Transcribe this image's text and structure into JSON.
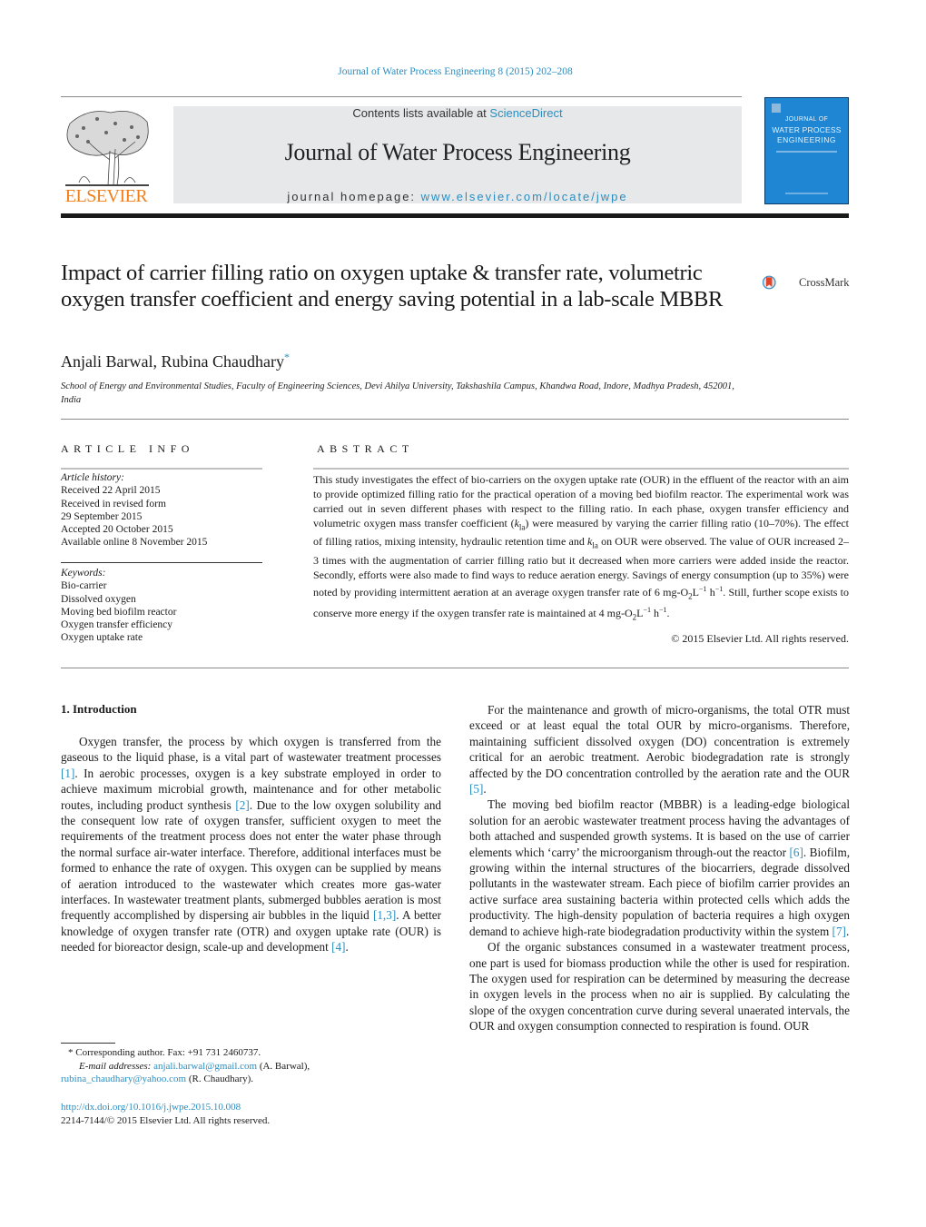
{
  "running_head": "Journal of Water Process Engineering 8 (2015) 202–208",
  "masthead": {
    "publisher": "ELSEVIER",
    "contents_prefix": "Contents lists available at ",
    "contents_link": "ScienceDirect",
    "journal_title": "Journal of Water Process Engineering",
    "homepage_prefix": "journal homepage: ",
    "homepage_link": "www.elsevier.com/locate/jwpe",
    "cover": {
      "line1": "JOURNAL OF",
      "line2": "WATER PROCESS",
      "line3": "ENGINEERING"
    }
  },
  "article": {
    "title": "Impact of carrier filling ratio on oxygen uptake & transfer rate, volumetric oxygen transfer coefficient and energy saving potential in a lab-scale MBBR",
    "crossmark_label": "CrossMark",
    "authors": "Anjali Barwal, Rubina Chaudhary",
    "corresponding_marker": "*",
    "affiliation": "School of Energy and Environmental Studies, Faculty of Engineering Sciences, Devi Ahilya University, Takshashila Campus, Khandwa Road, Indore, Madhya Pradesh, 452001, India"
  },
  "article_info": {
    "heading": "ARTICLE INFO",
    "history_label": "Article history:",
    "history": [
      "Received 22 April 2015",
      "Received in revised form",
      "29 September 2015",
      "Accepted 20 October 2015",
      "Available online 8 November 2015"
    ],
    "keywords_label": "Keywords:",
    "keywords": [
      "Bio-carrier",
      "Dissolved oxygen",
      "Moving bed biofilm reactor",
      "Oxygen transfer efficiency",
      "Oxygen uptake rate"
    ]
  },
  "abstract": {
    "heading": "ABSTRACT",
    "p1": "This study investigates the effect of bio-carriers on the oxygen uptake rate (OUR) in the effluent of the reactor with an aim to provide optimized filling ratio for the practical operation of a moving bed biofilm reactor. The experimental work was carried out in seven different phases with respect to the filling ratio. In each phase, oxygen transfer efficiency and volumetric oxygen mass transfer coefficient (",
    "kla_k": "k",
    "kla_sub": "la",
    "p2": ") were measured by varying the carrier filling ratio (10–70%). The effect of filling ratios, mixing intensity, hydraulic retention time and ",
    "p3": " on OUR were observed. The value of OUR increased 2–3 times with the augmentation of carrier filling ratio but it decreased when more carriers were added inside the reactor. Secondly, efforts were also made to find ways to reduce aeration energy. Savings of energy consumption (up to 35%) were noted by providing intermittent aeration at an average oxygen transfer rate of 6 mg-O",
    "p4": "L",
    "p5": " h",
    "p6": ". Still, further scope exists to conserve more energy if the oxygen transfer rate is maintained at 4 mg-O",
    "p7": ".",
    "sub2": "2",
    "sup_neg1": "−1",
    "copyright": "© 2015 Elsevier Ltd. All rights reserved."
  },
  "introduction": {
    "heading": "1.  Introduction",
    "left_paragraphs": [
      {
        "segments": [
          {
            "t": "Oxygen transfer, the process by which oxygen is transferred from the gaseous to the liquid phase, is a vital part of wastewater treatment processes "
          },
          {
            "ref": "[1]"
          },
          {
            "t": ". In aerobic processes, oxygen is a key substrate employed in order to achieve maximum microbial growth, maintenance and for other metabolic routes, including product synthesis "
          },
          {
            "ref": "[2]"
          },
          {
            "t": ". Due to the low oxygen solubility and the consequent low rate of oxygen transfer, sufficient oxygen to meet the requirements of the treatment process does not enter the water phase through the normal surface air-water interface. Therefore, additional interfaces must be formed to enhance the rate of oxygen. This oxygen can be supplied by means of aeration introduced to the wastewater which creates more gas-water interfaces. In wastewater treatment plants, submerged bubbles aeration is most frequently accomplished by dispersing air bubbles in the liquid "
          },
          {
            "ref": "[1,3]"
          },
          {
            "t": ". A better knowledge of oxygen transfer rate (OTR) and oxygen uptake rate (OUR) is needed for bioreactor design, scale-up and development "
          },
          {
            "ref": "[4]"
          },
          {
            "t": "."
          }
        ]
      }
    ],
    "right_paragraphs": [
      {
        "segments": [
          {
            "t": "For the maintenance and growth of micro-organisms, the total OTR must exceed or at least equal the total OUR by micro-organisms. Therefore, maintaining sufficient dissolved oxygen (DO) concentration is extremely critical for an aerobic treatment. Aerobic biodegradation rate is strongly affected by the DO concentration controlled by the aeration rate and the OUR "
          },
          {
            "ref": "[5]"
          },
          {
            "t": "."
          }
        ]
      },
      {
        "segments": [
          {
            "t": "The moving bed biofilm reactor (MBBR) is a leading-edge biological solution for an aerobic wastewater treatment process having the advantages of both attached and suspended growth systems. It is based on the use of carrier elements which ‘carry’ the microorganism through-out the reactor "
          },
          {
            "ref": "[6]"
          },
          {
            "t": ". Biofilm, growing within the internal structures of the biocarriers, degrade dissolved pollutants in the wastewater stream. Each piece of biofilm carrier provides an active surface area sustaining bacteria within protected cells which adds the productivity. The high-density population of bacteria requires a high oxygen demand to achieve high-rate biodegradation productivity within the system "
          },
          {
            "ref": "[7]"
          },
          {
            "t": "."
          }
        ]
      },
      {
        "segments": [
          {
            "t": "Of the organic substances consumed in a wastewater treatment process, one part is used for biomass production while the other is used for respiration. The oxygen used for respiration can be determined by measuring the decrease in oxygen levels in the process when no air is supplied. By calculating the slope of the oxygen concentration curve during several unaerated intervals, the OUR and oxygen consumption connected to respiration is found. OUR"
          }
        ]
      }
    ]
  },
  "footnotes": {
    "corresponding": "*  Corresponding author. Fax: +91 731 2460737.",
    "email_label": "E-mail addresses: ",
    "email1": "anjali.barwal@gmail.com",
    "email1_name": " (A. Barwal),",
    "email2": "rubina_chaudhary@yahoo.com",
    "email2_name": " (R. Chaudhary).",
    "doi": "http://dx.doi.org/10.1016/j.jwpe.2015.10.008",
    "issn": "2214-7144/© 2015 Elsevier Ltd. All rights reserved."
  },
  "colors": {
    "link": "#2a8ec0",
    "elsevier_orange": "#f07f1b",
    "masthead_gray": "#e7e8ea",
    "cover_blue": "#1e86d3"
  }
}
